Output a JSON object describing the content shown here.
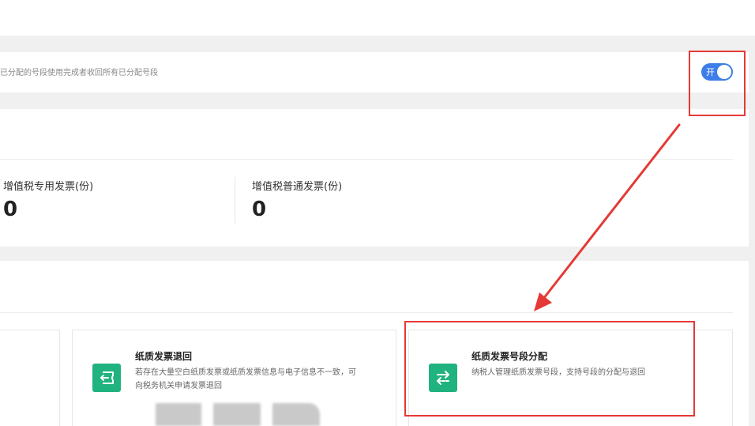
{
  "setting": {
    "description": "已分配的号段使用完成者收回所有已分配号段",
    "toggle_label": "开",
    "toggle_on": true
  },
  "stats": [
    {
      "label": "增值税专用发票(份)",
      "value": "0"
    },
    {
      "label": "增值税普通发票(份)",
      "value": "0"
    }
  ],
  "cards": [
    {
      "title": "纸质发票退回",
      "desc_line1": "若存在大量空白纸质发票或纸质发票信息与电子信息不一致，可",
      "desc_line2": "向税务机关申请发票退回",
      "icon": "return-icon"
    },
    {
      "title": "纸质发票号段分配",
      "desc_line1": "纳税人管理纸质发票号段，支持号段的分配与退回",
      "icon": "exchange-icon"
    }
  ],
  "colors": {
    "accent_blue": "#3d7de8",
    "icon_green": "#20b37f",
    "annotation_red": "#e53935"
  }
}
